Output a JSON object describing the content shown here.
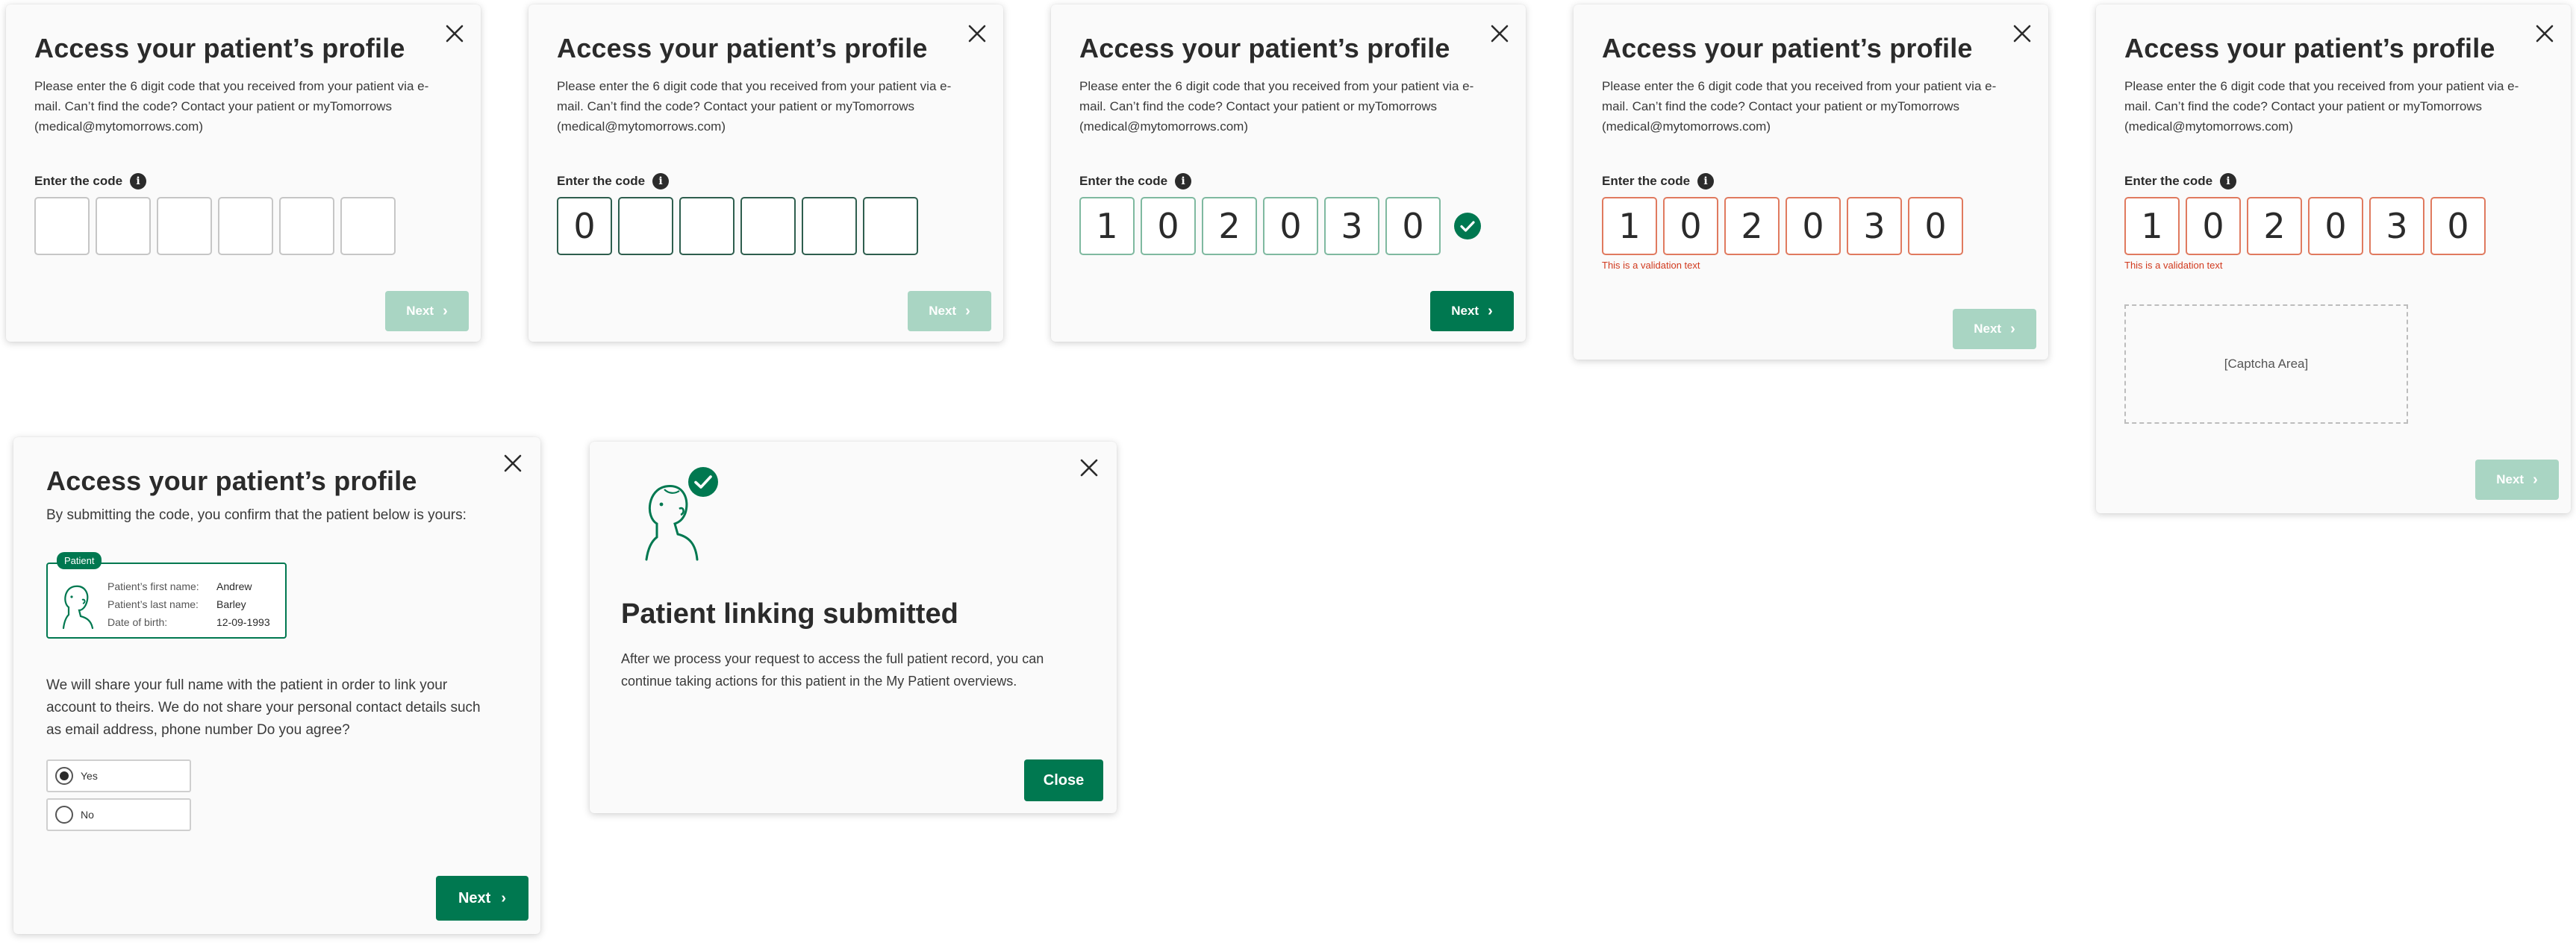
{
  "title": "Access your patient’s profile",
  "description": "Please enter the 6 digit code that you received from your patient via e-mail. Can’t find the code? Contact your patient or myTomorrows (medical@mytomorrows.com)",
  "code_label": "Enter the code",
  "info_glyph": "i",
  "next_label": "Next",
  "chevron": "›",
  "validation_text": "This is a validation text",
  "captcha_label": "[Captcha Area]",
  "screen2_digits": [
    "0",
    "",
    "",
    "",
    "",
    ""
  ],
  "code_digits": [
    "1",
    "0",
    "2",
    "0",
    "3",
    "0"
  ],
  "confirm": {
    "title": "Access your patient’s profile",
    "subtitle": "By submitting the code, you confirm that the patient below is yours:",
    "badge": "Patient",
    "first_name_label": "Patient’s first name:",
    "first_name": "Andrew",
    "last_name_label": "Patient’s last name:",
    "last_name": "Barley",
    "dob_label": "Date of birth:",
    "dob": "12-09-1993",
    "share_text": "We will share your full name with the patient in order to link your account to theirs. We do not share your personal contact details such as email address, phone number Do you agree?",
    "yes_label": "Yes",
    "no_label": "No",
    "selected": "Yes"
  },
  "success": {
    "title": "Patient linking submitted",
    "text": "After we process your request to access the full patient record, you can continue taking actions for this patient in the My Patient overviews.",
    "close_label": "Close"
  },
  "colors": {
    "primary": "#007850",
    "primary_disabled": "#a9d5c3",
    "error": "#e07a5f",
    "error_text": "#d13a1e"
  }
}
